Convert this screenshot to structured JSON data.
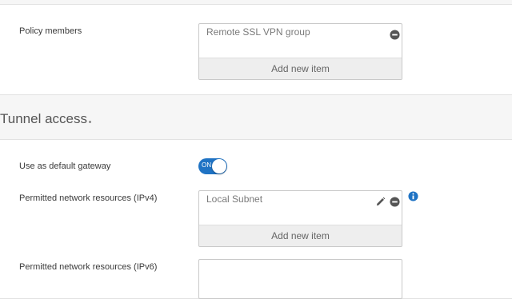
{
  "policy_members": {
    "label": "Policy members",
    "items": [
      {
        "text": "Remote SSL VPN group"
      }
    ],
    "add_label": "Add new item"
  },
  "tunnel_access": {
    "title": "Tunnel access",
    "default_gateway": {
      "label": "Use as default gateway",
      "toggle_text": "ON"
    },
    "ipv4": {
      "label": "Permitted network resources (IPv4)",
      "items": [
        {
          "text": "Local Subnet"
        }
      ],
      "add_label": "Add new item"
    },
    "ipv6": {
      "label": "Permitted network resources (IPv6)"
    }
  },
  "icons": {
    "remove": "minus-circle-icon",
    "edit": "pencil-icon",
    "info": "info-icon"
  },
  "colors": {
    "accent": "#1f73c4",
    "icon_dark": "#555555"
  }
}
